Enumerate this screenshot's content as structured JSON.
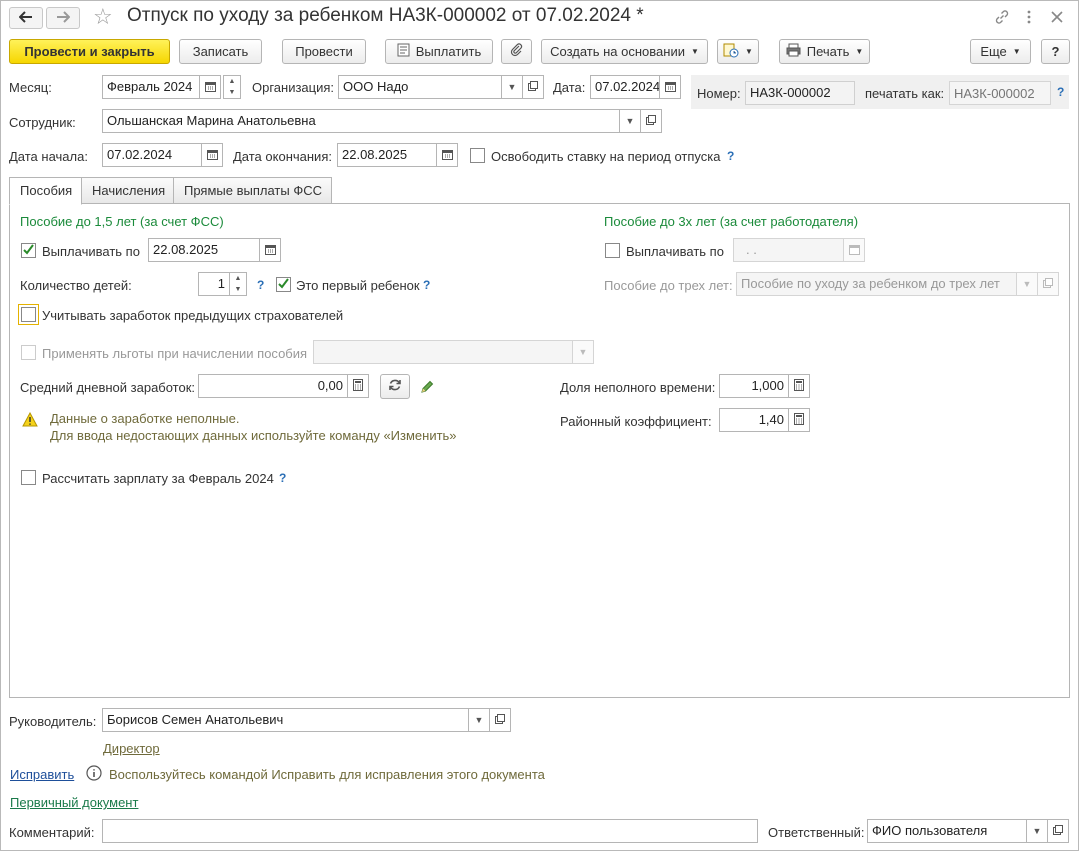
{
  "window": {
    "title": "Отпуск по уходу за ребенком НА3К-000002 от 07.02.2024 *",
    "icons": [
      "arrow-left-icon",
      "arrow-right-icon",
      "star-icon",
      "link-icon",
      "menu-dots-icon",
      "close-icon"
    ]
  },
  "toolbar": {
    "post_close": "Провести и закрыть",
    "save": "Записать",
    "post": "Провести",
    "pay": "Выплатить",
    "create_based": "Создать на основании",
    "print": "Печать",
    "more": "Еще",
    "help": "?"
  },
  "header": {
    "month_label": "Месяц:",
    "month_value": "Февраль 2024",
    "org_label": "Организация:",
    "org_value": "ООО Надо",
    "date_label": "Дата:",
    "date_value": "07.02.2024",
    "number_label": "Номер:",
    "number_value": "НА3К-000002",
    "print_as_label": "печатать как:",
    "print_as_placeholder": "НА3К-000002",
    "help": "?",
    "employee_label": "Сотрудник:",
    "employee_value": "Ольшанская Марина Анатольевна",
    "start_label": "Дата начала:",
    "start_value": "07.02.2024",
    "end_label": "Дата окончания:",
    "end_value": "22.08.2025",
    "release_rate_label": "Освободить ставку на период отпуска",
    "release_rate_checked": false
  },
  "tabs": [
    {
      "label": "Пособия",
      "active": true
    },
    {
      "label": "Начисления",
      "active": false
    },
    {
      "label": "Прямые выплаты ФСС",
      "active": false
    }
  ],
  "benefits": {
    "left_title": "Пособие до 1,5 лет (за счет ФСС)",
    "pay_label": "Выплачивать по",
    "pay_checked": true,
    "pay_until": "22.08.2025",
    "children_label": "Количество детей:",
    "children_value": "1",
    "first_child_label": "Это первый ребенок",
    "first_child_checked": true,
    "prev_insurers_label": "Учитывать заработок предыдущих страхователей",
    "prev_insurers_checked": false,
    "privileges_label": "Применять льготы при начислении пособия",
    "privileges_checked": false,
    "avg_earn_label": "Средний дневной заработок:",
    "avg_earn_value": "0,00",
    "warning_line1": "Данные о заработке неполные.",
    "warning_line2": "Для ввода недостающих данных используйте команду «Изменить»",
    "calc_salary_label": "Рассчитать зарплату за Февраль 2024",
    "calc_salary_checked": false,
    "right_title": "Пособие до 3х лет (за счет работодателя)",
    "pay3_label": "Выплачивать по",
    "pay3_checked": false,
    "pay3_value": ". .",
    "benefit3_label": "Пособие до трех лет:",
    "benefit3_value": "Пособие по уходу за ребенком до трех лет",
    "part_time_label": "Доля неполного времени:",
    "part_time_value": "1,000",
    "district_label": "Районный коэффициент:",
    "district_value": "1,40"
  },
  "footer": {
    "manager_label": "Руководитель:",
    "manager_value": "Борисов Семен Анатольевич",
    "position_link": "Директор",
    "fix_link": "Исправить",
    "fix_hint": "Воспользуйтесь командой Исправить для исправления этого документа",
    "primary_doc_link": "Первичный документ",
    "comment_label": "Комментарий:",
    "comment_value": "",
    "responsible_label": "Ответственный:",
    "responsible_value": "ФИО пользователя"
  },
  "colors": {
    "primary_button": "#f6d600",
    "section_title": "#1a8a3a",
    "help": "#2b6fb6",
    "warning_text": "#6f6a3b"
  }
}
